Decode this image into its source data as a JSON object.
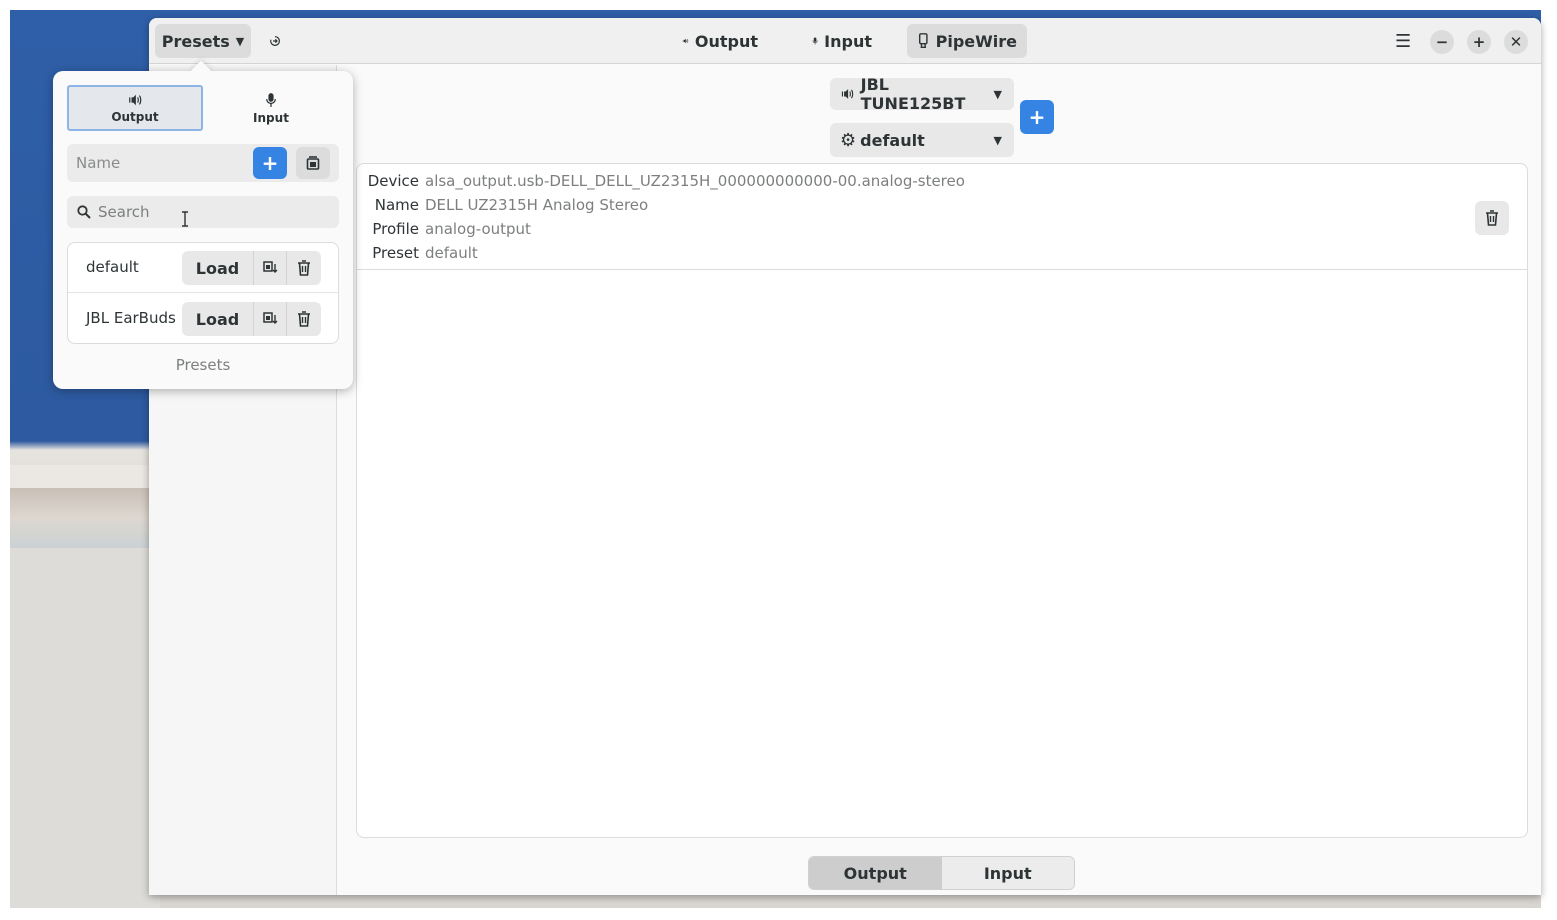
{
  "header": {
    "presets_label": "Presets",
    "tabs": [
      {
        "label": "Output",
        "icon": "speaker-icon"
      },
      {
        "label": "Input",
        "icon": "microphone-icon"
      },
      {
        "label": "PipeWire",
        "icon": "pipewire-icon",
        "active": true
      }
    ]
  },
  "device_selector": {
    "selected_device": "JBL TUNE125BT",
    "selected_preset": "default"
  },
  "device_info": {
    "device_key": "Device",
    "device_value": "alsa_output.usb-DELL_DELL_UZ2315H_000000000000-00.analog-stereo",
    "name_key": "Name",
    "name_value": "DELL UZ2315H Analog Stereo",
    "profile_key": "Profile",
    "profile_value": "analog-output",
    "preset_key": "Preset",
    "preset_value": "default"
  },
  "bottom_switcher": {
    "output_label": "Output",
    "input_label": "Input",
    "active": "Output"
  },
  "popover": {
    "tabs": [
      {
        "label": "Output",
        "icon": "speaker-icon",
        "active": true
      },
      {
        "label": "Input",
        "icon": "microphone-icon"
      }
    ],
    "name_placeholder": "Name",
    "search_placeholder": "Search",
    "presets": [
      {
        "name": "default",
        "load_label": "Load"
      },
      {
        "name": "JBL EarBuds",
        "load_label": "Load"
      }
    ],
    "footer": "Presets"
  },
  "colors": {
    "accent": "#3584e4",
    "wallpaper_blue": "#2f5fa8"
  }
}
